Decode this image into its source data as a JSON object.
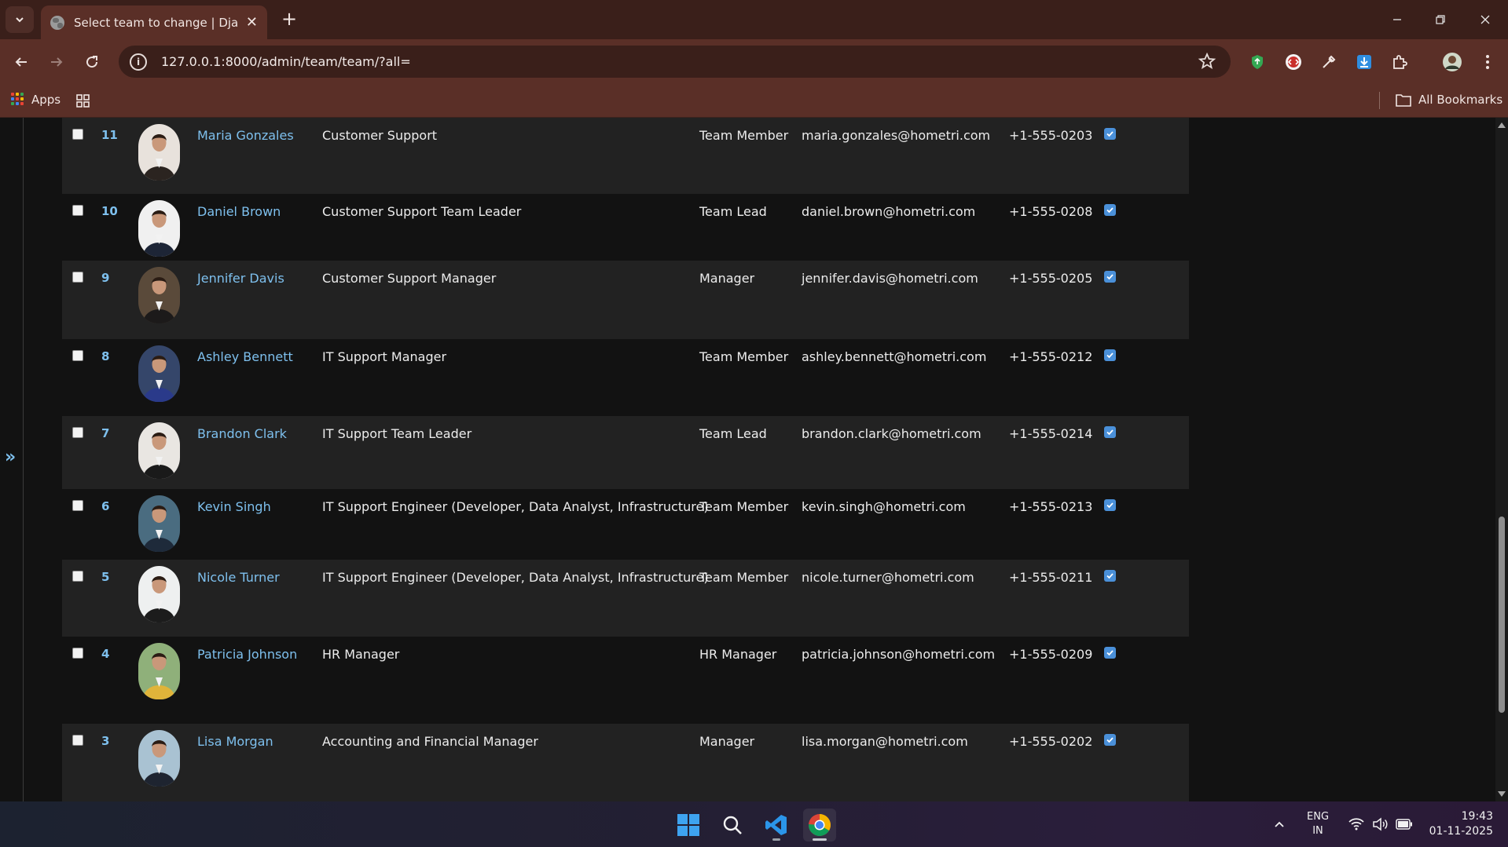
{
  "browser": {
    "tab_title": "Select team to change | Django",
    "url": "127.0.0.1:8000/admin/team/team/?all=",
    "bookmarks": {
      "apps_label": "Apps",
      "all_bookmarks_label": "All Bookmarks"
    }
  },
  "sidebar": {
    "toggle_glyph": "»"
  },
  "rows": [
    {
      "id": "11",
      "name": "Maria Gonzales",
      "position": "Customer Support",
      "role": "Team Member",
      "email": "maria.gonzales@hometri.com",
      "phone": "+1-555-0203",
      "active": true
    },
    {
      "id": "10",
      "name": "Daniel Brown",
      "position": "Customer Support Team Leader",
      "role": "Team Lead",
      "email": "daniel.brown@hometri.com",
      "phone": "+1-555-0208",
      "active": true
    },
    {
      "id": "9",
      "name": "Jennifer Davis",
      "position": "Customer Support Manager",
      "role": "Manager",
      "email": "jennifer.davis@hometri.com",
      "phone": "+1-555-0205",
      "active": true
    },
    {
      "id": "8",
      "name": "Ashley Bennett",
      "position": "IT Support Manager",
      "role": "Team Member",
      "email": "ashley.bennett@hometri.com",
      "phone": "+1-555-0212",
      "active": true
    },
    {
      "id": "7",
      "name": "Brandon Clark",
      "position": "IT Support Team Leader",
      "role": "Team Lead",
      "email": "brandon.clark@hometri.com",
      "phone": "+1-555-0214",
      "active": true
    },
    {
      "id": "6",
      "name": "Kevin Singh",
      "position": "IT Support Engineer (Developer, Data Analyst, Infrastructure)",
      "role": "Team Member",
      "email": "kevin.singh@hometri.com",
      "phone": "+1-555-0213",
      "active": true
    },
    {
      "id": "5",
      "name": "Nicole Turner",
      "position": "IT Support Engineer (Developer, Data Analyst, Infrastructure)",
      "role": "Team Member",
      "email": "nicole.turner@hometri.com",
      "phone": "+1-555-0211",
      "active": true
    },
    {
      "id": "4",
      "name": "Patricia Johnson",
      "position": "HR Manager",
      "role": "HR Manager",
      "email": "patricia.johnson@hometri.com",
      "phone": "+1-555-0209",
      "active": true
    },
    {
      "id": "3",
      "name": "Lisa Morgan",
      "position": "Accounting and Financial Manager",
      "role": "Manager",
      "email": "lisa.morgan@hometri.com",
      "phone": "+1-555-0202",
      "active": true
    }
  ],
  "taskbar": {
    "lang_line1": "ENG",
    "lang_line2": "IN",
    "time": "19:43",
    "date": "01-11-2025"
  },
  "colors": {
    "link": "#7ec0ee",
    "accent": "#4a90d9",
    "chrome": "#5a2f27"
  }
}
